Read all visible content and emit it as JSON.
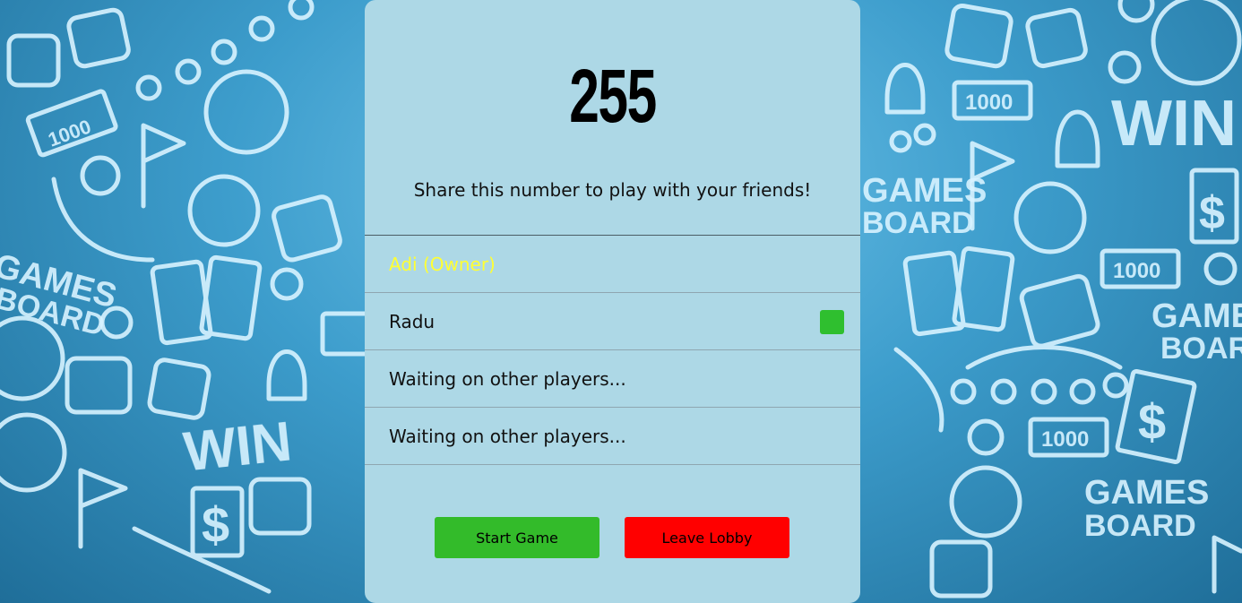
{
  "lobby": {
    "code": "255",
    "share_text": "Share this number to play with your friends!"
  },
  "players": [
    {
      "label": "Adi (Owner)",
      "owner": true,
      "ready": false
    },
    {
      "label": "Radu",
      "owner": false,
      "ready": true
    },
    {
      "label": "Waiting on other players...",
      "owner": false,
      "ready": false
    },
    {
      "label": "Waiting on other players...",
      "owner": false,
      "ready": false
    }
  ],
  "actions": {
    "start_label": "Start Game",
    "leave_label": "Leave Lobby"
  },
  "background": {
    "decor_texts": [
      "WIN",
      "GAMES",
      "BOARD",
      "1000",
      "$"
    ]
  },
  "colors": {
    "card": "#add8e6",
    "owner_name": "#ffff33",
    "ready": "#2fbf2f",
    "start_button": "#33bb2a",
    "leave_button": "#ff0000"
  }
}
